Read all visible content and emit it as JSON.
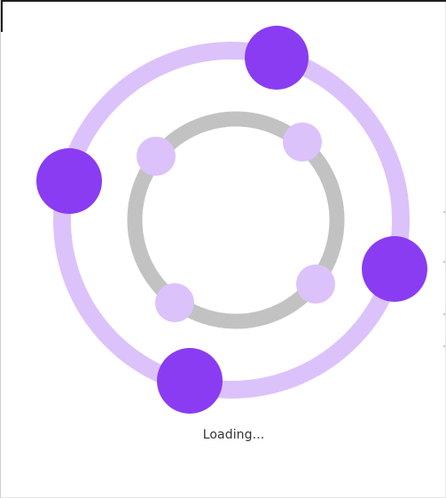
{
  "status": {
    "loading_text": "Loading..."
  },
  "colors": {
    "outer_ring": "#dcc2fb",
    "inner_ring": "#c2c2c2",
    "outer_dot": "#8a3cf2",
    "inner_dot": "#dcc2fb",
    "background": "#ffffff"
  },
  "loader": {
    "outer_dot_count": 4,
    "inner_dot_count": 4
  }
}
